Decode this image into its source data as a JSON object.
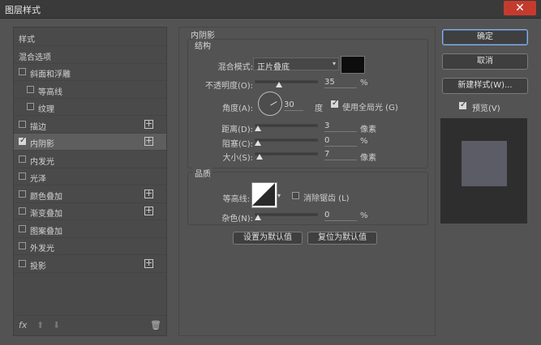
{
  "window": {
    "title": "图层样式",
    "close_icon": "close-icon"
  },
  "left_list": {
    "items": [
      {
        "label": "样式",
        "checkbox": false,
        "checked": false,
        "plus": false,
        "indent": 0
      },
      {
        "label": "混合选项",
        "checkbox": false,
        "checked": false,
        "plus": false,
        "indent": 0
      },
      {
        "label": "斜面和浮雕",
        "checkbox": true,
        "checked": false,
        "plus": false,
        "indent": 0
      },
      {
        "label": "等高线",
        "checkbox": true,
        "checked": false,
        "plus": false,
        "indent": 1
      },
      {
        "label": "纹理",
        "checkbox": true,
        "checked": false,
        "plus": false,
        "indent": 1
      },
      {
        "label": "描边",
        "checkbox": true,
        "checked": false,
        "plus": true,
        "indent": 0
      },
      {
        "label": "内阴影",
        "checkbox": true,
        "checked": true,
        "plus": true,
        "indent": 0,
        "selected": true
      },
      {
        "label": "内发光",
        "checkbox": true,
        "checked": false,
        "plus": false,
        "indent": 0
      },
      {
        "label": "光泽",
        "checkbox": true,
        "checked": false,
        "plus": false,
        "indent": 0
      },
      {
        "label": "颜色叠加",
        "checkbox": true,
        "checked": false,
        "plus": true,
        "indent": 0
      },
      {
        "label": "渐变叠加",
        "checkbox": true,
        "checked": false,
        "plus": true,
        "indent": 0
      },
      {
        "label": "图案叠加",
        "checkbox": true,
        "checked": false,
        "plus": false,
        "indent": 0
      },
      {
        "label": "外发光",
        "checkbox": true,
        "checked": false,
        "plus": false,
        "indent": 0
      },
      {
        "label": "投影",
        "checkbox": true,
        "checked": false,
        "plus": true,
        "indent": 0
      }
    ],
    "bottom": {
      "fx": "fx",
      "up_icon": "arrow-up-icon",
      "down_icon": "arrow-down-icon",
      "trash_icon": "trash-icon"
    }
  },
  "inner_shadow": {
    "section_title": "内阴影",
    "structure": {
      "title": "结构",
      "blend_mode_label": "混合模式:",
      "blend_mode_value": "正片叠底",
      "shadow_color": "#0d0d0d",
      "opacity_label": "不透明度(O):",
      "opacity_value": "35",
      "opacity_unit": "%",
      "angle_label": "角度(A):",
      "angle_value": "30",
      "angle_unit": "度",
      "global_light_label": "使用全局光 (G)",
      "global_light_checked": true,
      "distance_label": "距离(D):",
      "distance_value": "3",
      "distance_unit": "像素",
      "choke_label": "阻塞(C):",
      "choke_value": "0",
      "choke_unit": "%",
      "size_label": "大小(S):",
      "size_value": "7",
      "size_unit": "像素"
    },
    "quality": {
      "title": "品质",
      "contour_label": "等高线:",
      "antialias_label": "消除锯齿 (L)",
      "antialias_checked": false,
      "noise_label": "杂色(N):",
      "noise_value": "0",
      "noise_unit": "%"
    },
    "make_default_label": "设置为默认值",
    "reset_default_label": "复位为默认值"
  },
  "right": {
    "ok_label": "确定",
    "cancel_label": "取消",
    "new_style_label": "新建样式(W)...",
    "preview_label": "预览(V)",
    "preview_checked": true
  }
}
